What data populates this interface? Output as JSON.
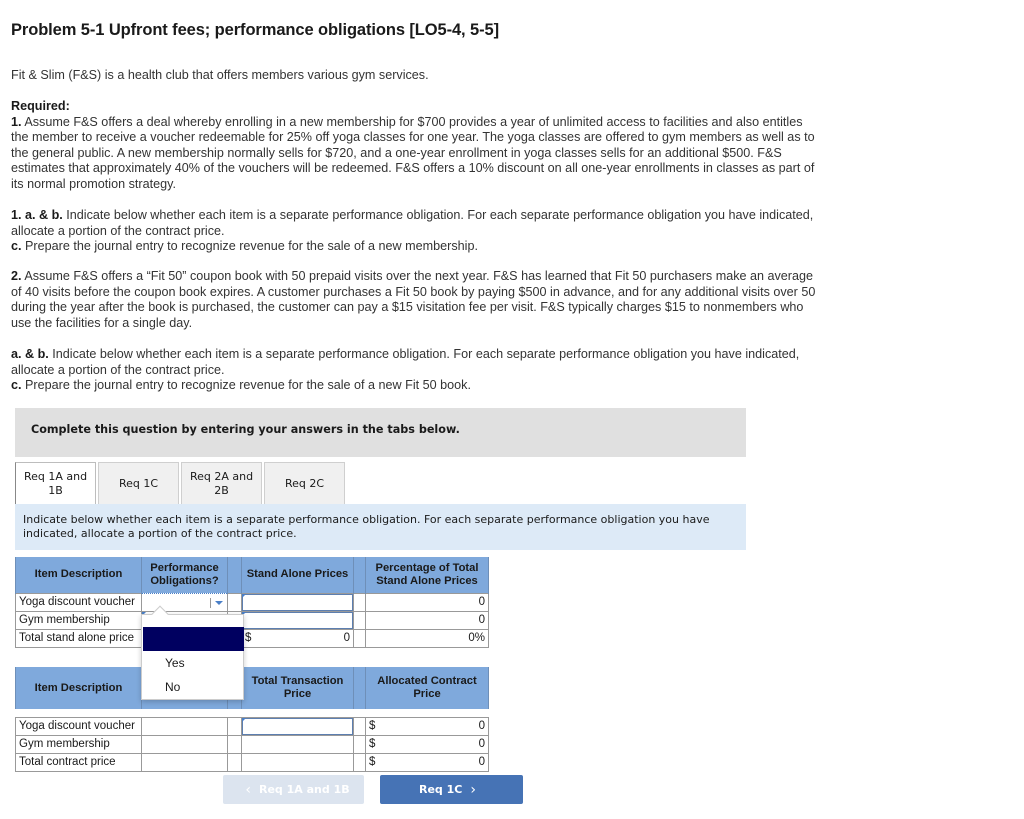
{
  "title": "Problem 5-1 Upfront fees; performance obligations [LO5-4, 5-5]",
  "intro": "Fit & Slim (F&S) is a health club that offers members various gym services.",
  "required_label": "Required:",
  "req1": {
    "num": "1.",
    "text": "Assume F&S offers a deal whereby enrolling in a new membership for $700 provides a year of unlimited access to facilities and also entitles the member to receive a voucher redeemable for 25% off yoga classes for one year. The yoga classes are offered to gym members as well as to the general public. A new membership normally sells for $720, and a one-year enrollment in yoga classes sells for an additional $500. F&S estimates that approximately 40% of the vouchers will be redeemed. F&S offers a 10% discount on all one-year enrollments in classes as part of its normal promotion strategy."
  },
  "req1ab": {
    "label": "1. a. & b.",
    "text": "Indicate below whether each item is a separate performance obligation. For each separate performance obligation you have indicated, allocate a portion of the contract price."
  },
  "req1c": {
    "label": "c.",
    "text": "Prepare the journal entry to recognize revenue for the sale of a new membership."
  },
  "req2": {
    "num": "2.",
    "text": "Assume F&S offers a “Fit 50” coupon book with 50 prepaid visits over the next year. F&S has learned that Fit 50 purchasers make an average of 40 visits before the coupon book expires. A customer purchases a Fit 50 book by paying $500 in advance, and for any additional visits over 50 during the year after the book is purchased, the customer can pay a $15 visitation fee per visit. F&S typically charges $15 to nonmembers who use the facilities for a single day."
  },
  "req2ab": {
    "label": "a. & b.",
    "text": "Indicate below whether each item is a separate performance obligation. For each separate performance obligation you have indicated, allocate a portion of the contract price."
  },
  "req2c": {
    "label": "c.",
    "text": "Prepare the journal entry to recognize revenue for the sale of a new Fit 50 book."
  },
  "banner": "Complete this question by entering your answers in the tabs below.",
  "tabs": [
    {
      "label": "Req 1A and 1B",
      "active": true
    },
    {
      "label": "Req 1C",
      "active": false
    },
    {
      "label": "Req 2A and 2B",
      "active": false
    },
    {
      "label": "Req 2C",
      "active": false
    }
  ],
  "instruction": "Indicate below whether each item is a separate performance obligation. For each separate performance obligation you have indicated, allocate a portion of the contract price.",
  "table1": {
    "headers": [
      "Item Description",
      "Performance Obligations?",
      "Stand Alone Prices",
      "Percentage of Total Stand Alone Prices"
    ],
    "rows": [
      {
        "desc": "Yoga discount voucher",
        "obligation": "",
        "price": "",
        "pct": "0"
      },
      {
        "desc": "Gym membership",
        "obligation": "",
        "price": "",
        "pct": "0"
      }
    ],
    "total": {
      "desc": "Total stand alone price",
      "currency": "$",
      "price": "0",
      "pct": "0%"
    }
  },
  "dropdown": {
    "options": [
      "",
      "Yes",
      "No"
    ],
    "highlighted": 0
  },
  "table2": {
    "headers": [
      "Item Description",
      "",
      "Total Transaction Price",
      "Allocated Contract Price"
    ],
    "rows": [
      {
        "desc": "Yoga discount voucher",
        "price": "",
        "currency": "$",
        "allocated": "0"
      },
      {
        "desc": "Gym membership",
        "price": "",
        "currency": "$",
        "allocated": "0"
      }
    ],
    "total": {
      "desc": "Total contract price",
      "currency": "$",
      "allocated": "0"
    }
  },
  "nav": {
    "prev_label": "Req 1A and 1B",
    "prev_icon": "‹",
    "next_label": "Req 1C",
    "next_icon": "›"
  }
}
